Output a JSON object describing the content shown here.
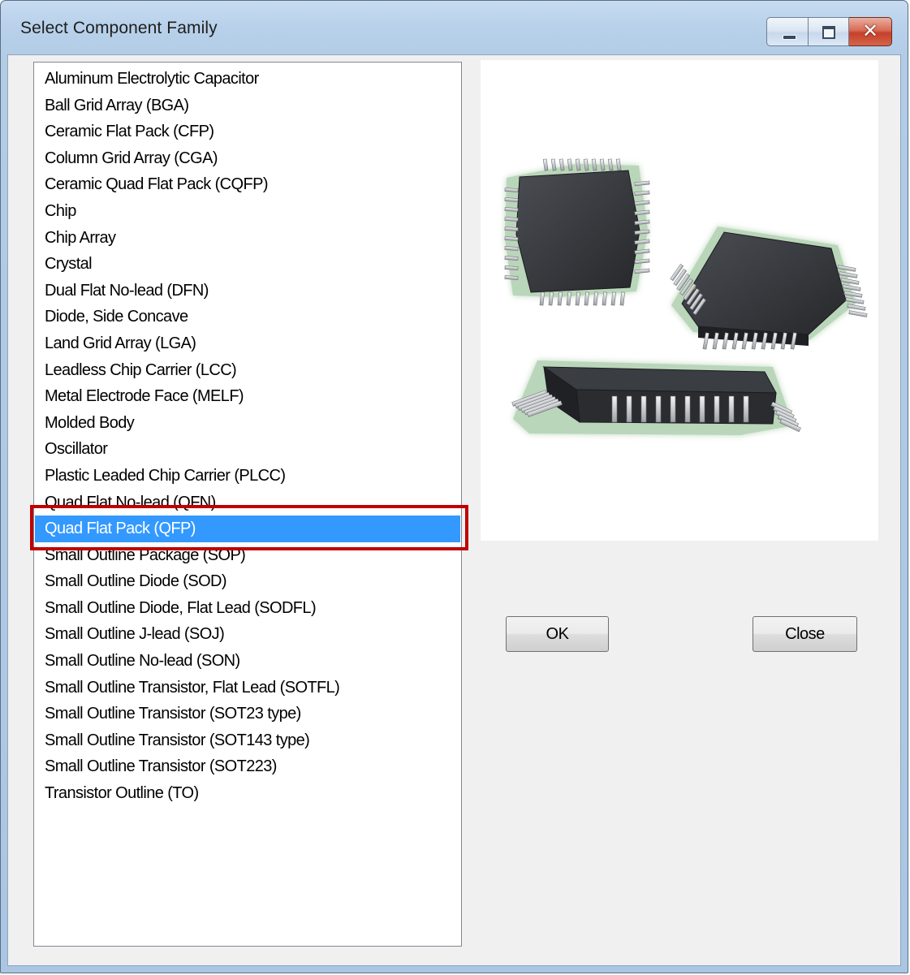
{
  "window": {
    "title": "Select Component Family",
    "caption_buttons": {
      "minimize_icon": "minimize-icon",
      "maximize_icon": "maximize-icon",
      "close_icon": "close-icon",
      "close_glyph": "✕"
    }
  },
  "component_list": {
    "items": [
      "Aluminum Electrolytic Capacitor",
      "Ball Grid Array (BGA)",
      "Ceramic Flat Pack (CFP)",
      "Column Grid Array (CGA)",
      "Ceramic Quad Flat Pack (CQFP)",
      "Chip",
      "Chip Array",
      "Crystal",
      "Dual Flat No-lead (DFN)",
      "Diode, Side Concave",
      "Land Grid Array (LGA)",
      "Leadless Chip Carrier (LCC)",
      "Metal Electrode Face (MELF)",
      "Molded Body",
      "Oscillator",
      "Plastic Leaded Chip Carrier (PLCC)",
      "Quad Flat No-lead (QFN)",
      "Quad Flat Pack (QFP)",
      "Small Outline Package (SOP)",
      "Small Outline Diode (SOD)",
      "Small Outline Diode, Flat Lead (SODFL)",
      "Small Outline J-lead (SOJ)",
      "Small Outline No-lead (SON)",
      "Small Outline Transistor, Flat Lead (SOTFL)",
      "Small Outline Transistor (SOT23 type)",
      "Small Outline Transistor (SOT143 type)",
      "Small Outline Transistor (SOT223)",
      "Transistor Outline (TO)"
    ],
    "selected_index": 17,
    "selected_label": "Quad Flat Pack (QFP)"
  },
  "preview": {
    "image": "qfp-package-illustration",
    "colors": {
      "body": "#2d2f33",
      "body_top": "#3a3d42",
      "leads": "#d8dadc",
      "glow": "#3c8c3c"
    }
  },
  "buttons": {
    "ok_label": "OK",
    "close_label": "Close"
  },
  "colors": {
    "selection": "#3399ff",
    "highlight_box": "#c00000",
    "dialog_background": "#f0f0f0",
    "titlebar": "#b9d1ea"
  }
}
